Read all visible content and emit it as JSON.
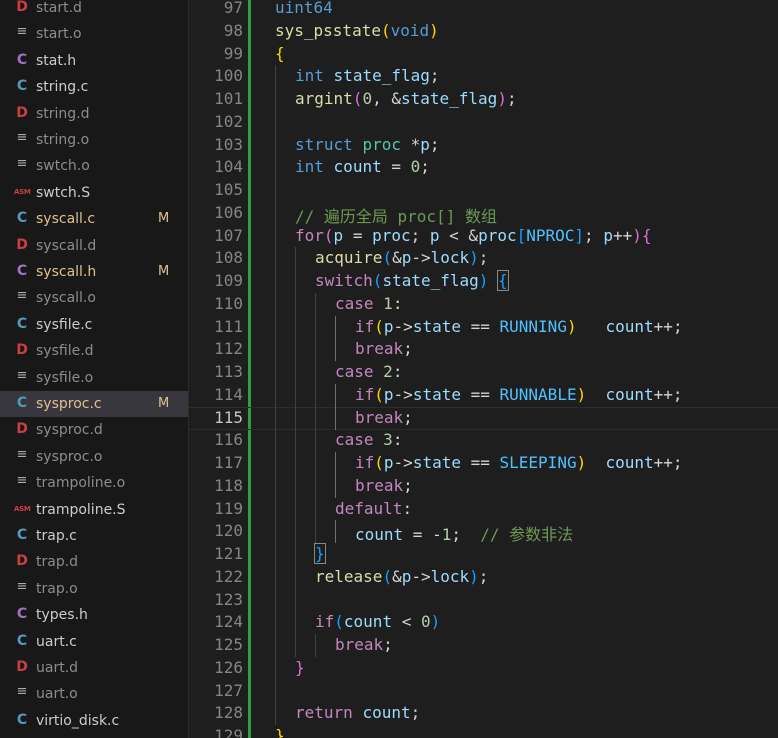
{
  "explorer": {
    "files": [
      {
        "name": "start.d",
        "icon": "D",
        "kind": "d",
        "dim": true,
        "modified": false
      },
      {
        "name": "start.o",
        "icon": "≡",
        "kind": "o",
        "dim": true,
        "modified": false
      },
      {
        "name": "stat.h",
        "icon": "C",
        "kind": "h",
        "dim": false,
        "modified": false
      },
      {
        "name": "string.c",
        "icon": "C",
        "kind": "c",
        "dim": false,
        "modified": false
      },
      {
        "name": "string.d",
        "icon": "D",
        "kind": "d",
        "dim": true,
        "modified": false
      },
      {
        "name": "string.o",
        "icon": "≡",
        "kind": "o",
        "dim": true,
        "modified": false
      },
      {
        "name": "swtch.o",
        "icon": "≡",
        "kind": "o",
        "dim": true,
        "modified": false
      },
      {
        "name": "swtch.S",
        "icon": "ASM",
        "kind": "asm",
        "dim": false,
        "modified": false
      },
      {
        "name": "syscall.c",
        "icon": "C",
        "kind": "c",
        "dim": false,
        "modified": true,
        "badge": "M"
      },
      {
        "name": "syscall.d",
        "icon": "D",
        "kind": "d",
        "dim": true,
        "modified": false
      },
      {
        "name": "syscall.h",
        "icon": "C",
        "kind": "h",
        "dim": false,
        "modified": true,
        "badge": "M"
      },
      {
        "name": "syscall.o",
        "icon": "≡",
        "kind": "o",
        "dim": true,
        "modified": false
      },
      {
        "name": "sysfile.c",
        "icon": "C",
        "kind": "c",
        "dim": false,
        "modified": false
      },
      {
        "name": "sysfile.d",
        "icon": "D",
        "kind": "d",
        "dim": true,
        "modified": false
      },
      {
        "name": "sysfile.o",
        "icon": "≡",
        "kind": "o",
        "dim": true,
        "modified": false
      },
      {
        "name": "sysproc.c",
        "icon": "C",
        "kind": "c",
        "dim": false,
        "modified": true,
        "badge": "M",
        "selected": true
      },
      {
        "name": "sysproc.d",
        "icon": "D",
        "kind": "d",
        "dim": true,
        "modified": false
      },
      {
        "name": "sysproc.o",
        "icon": "≡",
        "kind": "o",
        "dim": true,
        "modified": false
      },
      {
        "name": "trampoline.o",
        "icon": "≡",
        "kind": "o",
        "dim": true,
        "modified": false
      },
      {
        "name": "trampoline.S",
        "icon": "ASM",
        "kind": "asm",
        "dim": false,
        "modified": false
      },
      {
        "name": "trap.c",
        "icon": "C",
        "kind": "c",
        "dim": false,
        "modified": false
      },
      {
        "name": "trap.d",
        "icon": "D",
        "kind": "d",
        "dim": true,
        "modified": false
      },
      {
        "name": "trap.o",
        "icon": "≡",
        "kind": "o",
        "dim": true,
        "modified": false
      },
      {
        "name": "types.h",
        "icon": "C",
        "kind": "h",
        "dim": false,
        "modified": false
      },
      {
        "name": "uart.c",
        "icon": "C",
        "kind": "c",
        "dim": false,
        "modified": false
      },
      {
        "name": "uart.d",
        "icon": "D",
        "kind": "d",
        "dim": true,
        "modified": false
      },
      {
        "name": "uart.o",
        "icon": "≡",
        "kind": "o",
        "dim": true,
        "modified": false
      },
      {
        "name": "virtio_disk.c",
        "icon": "C",
        "kind": "c",
        "dim": false,
        "modified": false
      }
    ]
  },
  "editor": {
    "current_line": 115,
    "lines": [
      {
        "n": "97",
        "indent": 0,
        "tokens": [
          [
            "uint64",
            "type"
          ]
        ]
      },
      {
        "n": "98",
        "indent": 0,
        "tokens": [
          [
            "sys_psstate",
            "func"
          ],
          [
            "(",
            "b1"
          ],
          [
            "void",
            "type"
          ],
          [
            ")",
            "b1"
          ]
        ]
      },
      {
        "n": "99",
        "indent": 0,
        "tokens": [
          [
            "{",
            "b1"
          ]
        ]
      },
      {
        "n": "100",
        "indent": 1,
        "tokens": [
          [
            "int",
            "type"
          ],
          [
            " ",
            "plain"
          ],
          [
            "state_flag",
            "var"
          ],
          [
            ";",
            "plain"
          ]
        ]
      },
      {
        "n": "101",
        "indent": 1,
        "tokens": [
          [
            "argint",
            "func"
          ],
          [
            "(",
            "b2"
          ],
          [
            "0",
            "num"
          ],
          [
            ", &",
            "plain"
          ],
          [
            "state_flag",
            "var"
          ],
          [
            ")",
            "b2"
          ],
          [
            ";",
            "plain"
          ]
        ]
      },
      {
        "n": "102",
        "indent": 1,
        "tokens": []
      },
      {
        "n": "103",
        "indent": 1,
        "tokens": [
          [
            "struct",
            "type"
          ],
          [
            " ",
            "plain"
          ],
          [
            "proc",
            "struct"
          ],
          [
            " *",
            "plain"
          ],
          [
            "p",
            "var"
          ],
          [
            ";",
            "plain"
          ]
        ]
      },
      {
        "n": "104",
        "indent": 1,
        "tokens": [
          [
            "int",
            "type"
          ],
          [
            " ",
            "plain"
          ],
          [
            "count",
            "var"
          ],
          [
            " = ",
            "plain"
          ],
          [
            "0",
            "num"
          ],
          [
            ";",
            "plain"
          ]
        ]
      },
      {
        "n": "105",
        "indent": 1,
        "tokens": []
      },
      {
        "n": "106",
        "indent": 1,
        "tokens": [
          [
            "// 遍历全局 proc[] 数组",
            "com"
          ]
        ]
      },
      {
        "n": "107",
        "indent": 1,
        "tokens": [
          [
            "for",
            "ctrl"
          ],
          [
            "(",
            "b2"
          ],
          [
            "p",
            "var"
          ],
          [
            " = ",
            "plain"
          ],
          [
            "proc",
            "var"
          ],
          [
            "; ",
            "plain"
          ],
          [
            "p",
            "var"
          ],
          [
            " < &",
            "plain"
          ],
          [
            "proc",
            "var"
          ],
          [
            "[",
            "b3"
          ],
          [
            "NPROC",
            "const"
          ],
          [
            "]",
            "b3"
          ],
          [
            "; ",
            "plain"
          ],
          [
            "p",
            "var"
          ],
          [
            "++",
            "plain"
          ],
          [
            ")",
            "b2"
          ],
          [
            "{",
            "b2"
          ]
        ]
      },
      {
        "n": "108",
        "indent": 2,
        "tokens": [
          [
            "acquire",
            "func"
          ],
          [
            "(",
            "b3"
          ],
          [
            "&",
            "plain"
          ],
          [
            "p",
            "var"
          ],
          [
            "->",
            "plain"
          ],
          [
            "lock",
            "var"
          ],
          [
            ")",
            "b3"
          ],
          [
            ";",
            "plain"
          ]
        ]
      },
      {
        "n": "109",
        "indent": 2,
        "tokens": [
          [
            "switch",
            "ctrl"
          ],
          [
            "(",
            "b3"
          ],
          [
            "state_flag",
            "var"
          ],
          [
            ")",
            "b3"
          ],
          [
            " ",
            "plain"
          ],
          [
            "{",
            "b3m"
          ]
        ]
      },
      {
        "n": "110",
        "indent": 3,
        "tokens": [
          [
            "case",
            "ctrl"
          ],
          [
            " ",
            "plain"
          ],
          [
            "1",
            "num"
          ],
          [
            ":",
            "plain"
          ]
        ]
      },
      {
        "n": "111",
        "indent": 4,
        "tokens": [
          [
            "if",
            "ctrl"
          ],
          [
            "(",
            "b1"
          ],
          [
            "p",
            "var"
          ],
          [
            "->",
            "plain"
          ],
          [
            "state",
            "var"
          ],
          [
            " == ",
            "plain"
          ],
          [
            "RUNNING",
            "const"
          ],
          [
            ")",
            "b1"
          ],
          [
            "   ",
            "plain"
          ],
          [
            "count",
            "var"
          ],
          [
            "++;",
            "plain"
          ]
        ]
      },
      {
        "n": "112",
        "indent": 4,
        "tokens": [
          [
            "break",
            "ctrl"
          ],
          [
            ";",
            "plain"
          ]
        ]
      },
      {
        "n": "113",
        "indent": 3,
        "tokens": [
          [
            "case",
            "ctrl"
          ],
          [
            " ",
            "plain"
          ],
          [
            "2",
            "num"
          ],
          [
            ":",
            "plain"
          ]
        ]
      },
      {
        "n": "114",
        "indent": 4,
        "tokens": [
          [
            "if",
            "ctrl"
          ],
          [
            "(",
            "b1"
          ],
          [
            "p",
            "var"
          ],
          [
            "->",
            "plain"
          ],
          [
            "state",
            "var"
          ],
          [
            " == ",
            "plain"
          ],
          [
            "RUNNABLE",
            "const"
          ],
          [
            ")",
            "b1"
          ],
          [
            "  ",
            "plain"
          ],
          [
            "count",
            "var"
          ],
          [
            "++;",
            "plain"
          ]
        ]
      },
      {
        "n": "115",
        "indent": 4,
        "tokens": [
          [
            "break",
            "ctrl"
          ],
          [
            ";",
            "plain"
          ]
        ]
      },
      {
        "n": "116",
        "indent": 3,
        "tokens": [
          [
            "case",
            "ctrl"
          ],
          [
            " ",
            "plain"
          ],
          [
            "3",
            "num"
          ],
          [
            ":",
            "plain"
          ]
        ]
      },
      {
        "n": "117",
        "indent": 4,
        "tokens": [
          [
            "if",
            "ctrl"
          ],
          [
            "(",
            "b1"
          ],
          [
            "p",
            "var"
          ],
          [
            "->",
            "plain"
          ],
          [
            "state",
            "var"
          ],
          [
            " == ",
            "plain"
          ],
          [
            "SLEEPING",
            "const"
          ],
          [
            ")",
            "b1"
          ],
          [
            "  ",
            "plain"
          ],
          [
            "count",
            "var"
          ],
          [
            "++;",
            "plain"
          ]
        ]
      },
      {
        "n": "118",
        "indent": 4,
        "tokens": [
          [
            "break",
            "ctrl"
          ],
          [
            ";",
            "plain"
          ]
        ]
      },
      {
        "n": "119",
        "indent": 3,
        "tokens": [
          [
            "default",
            "ctrl"
          ],
          [
            ":",
            "plain"
          ]
        ]
      },
      {
        "n": "120",
        "indent": 4,
        "tokens": [
          [
            "count",
            "var"
          ],
          [
            " = -",
            "plain"
          ],
          [
            "1",
            "num"
          ],
          [
            ";  ",
            "plain"
          ],
          [
            "// 参数非法",
            "com"
          ]
        ]
      },
      {
        "n": "121",
        "indent": 2,
        "tokens": [
          [
            "}",
            "b3m"
          ]
        ]
      },
      {
        "n": "122",
        "indent": 2,
        "tokens": [
          [
            "release",
            "func"
          ],
          [
            "(",
            "b3"
          ],
          [
            "&",
            "plain"
          ],
          [
            "p",
            "var"
          ],
          [
            "->",
            "plain"
          ],
          [
            "lock",
            "var"
          ],
          [
            ")",
            "b3"
          ],
          [
            ";",
            "plain"
          ]
        ]
      },
      {
        "n": "123",
        "indent": 2,
        "tokens": []
      },
      {
        "n": "124",
        "indent": 2,
        "tokens": [
          [
            "if",
            "ctrl"
          ],
          [
            "(",
            "b3"
          ],
          [
            "count",
            "var"
          ],
          [
            " < ",
            "plain"
          ],
          [
            "0",
            "num"
          ],
          [
            ")",
            "b3"
          ]
        ]
      },
      {
        "n": "125",
        "indent": 3,
        "tokens": [
          [
            "break",
            "ctrl"
          ],
          [
            ";",
            "plain"
          ]
        ]
      },
      {
        "n": "126",
        "indent": 1,
        "tokens": [
          [
            "}",
            "b2"
          ]
        ]
      },
      {
        "n": "127",
        "indent": 1,
        "tokens": []
      },
      {
        "n": "128",
        "indent": 1,
        "tokens": [
          [
            "return",
            "ctrl"
          ],
          [
            " ",
            "plain"
          ],
          [
            "count",
            "var"
          ],
          [
            ";",
            "plain"
          ]
        ]
      },
      {
        "n": "129",
        "indent": 0,
        "tokens": [
          [
            "}",
            "b1"
          ]
        ]
      }
    ]
  }
}
